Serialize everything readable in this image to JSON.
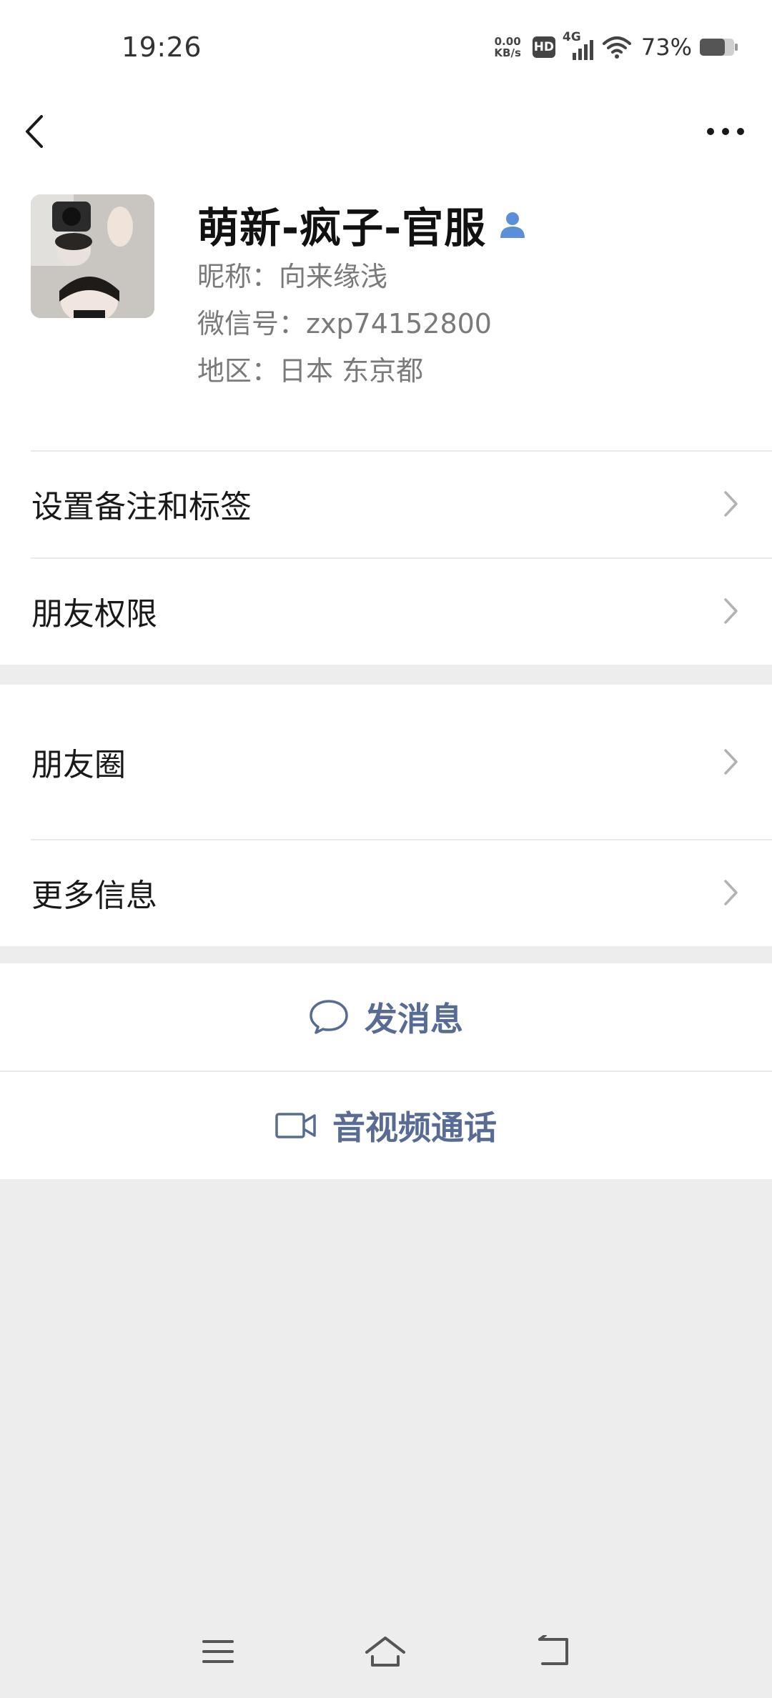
{
  "status": {
    "time": "19:26",
    "net_speed_value": "0.00",
    "net_speed_unit": "KB/s",
    "hd_label": "HD",
    "network_label": "4G",
    "battery_percent": "73%",
    "battery_level": 0.73
  },
  "profile": {
    "display_name": "萌新-疯子-官服",
    "nickname_line": "昵称：向来缘浅",
    "wechat_id_line": "微信号：zxp74152800",
    "region_line": "地区：日本  东京都"
  },
  "menu_group_1": [
    {
      "label": "设置备注和标签"
    },
    {
      "label": "朋友权限"
    }
  ],
  "menu_group_2": [
    {
      "label": "朋友圈"
    },
    {
      "label": "更多信息"
    }
  ],
  "actions": [
    {
      "label": "发消息",
      "icon": "chat-bubble-icon"
    },
    {
      "label": "音视频通话",
      "icon": "video-camera-icon"
    }
  ],
  "colors": {
    "link_blue": "#576b95",
    "contact_icon_blue": "#5b8fd9",
    "page_gray": "#ededed"
  }
}
